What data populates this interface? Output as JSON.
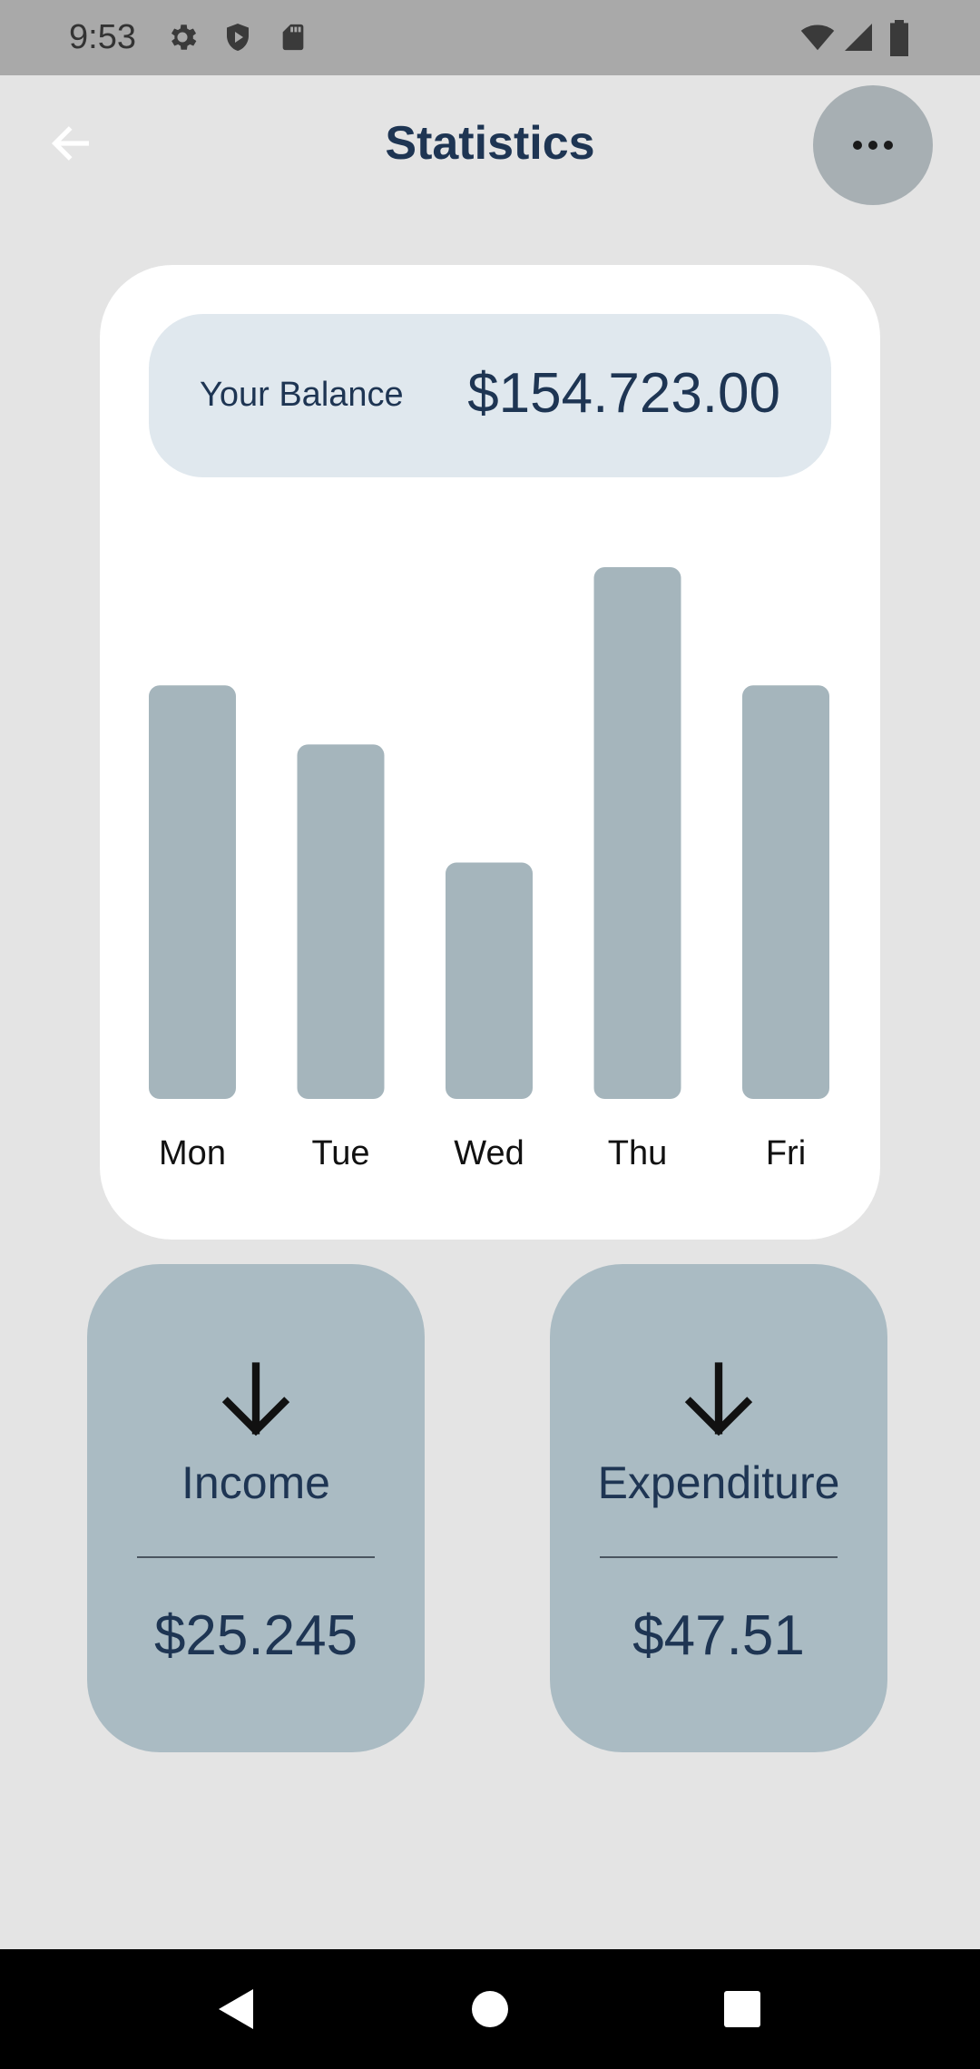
{
  "status_bar": {
    "time": "9:53",
    "left_icons": [
      "gear-icon",
      "shield-icon",
      "sd-card-icon"
    ],
    "right_icons": [
      "wifi-icon",
      "signal-icon",
      "battery-icon"
    ]
  },
  "header": {
    "title": "Statistics",
    "back_icon": "arrow-left-icon",
    "more_icon": "more-horizontal-icon"
  },
  "balance": {
    "label": "Your Balance",
    "value": "$154.723.00"
  },
  "chart_data": {
    "type": "bar",
    "categories": [
      "Mon",
      "Tue",
      "Wed",
      "Thu",
      "Fri"
    ],
    "values": [
      7,
      6,
      4,
      9,
      7
    ],
    "ylim": [
      0,
      9
    ],
    "grid": false,
    "bar_color": "#a5b5bc"
  },
  "income": {
    "title": "Income",
    "value": "$25.245",
    "icon": "arrow-down-icon"
  },
  "expenditure": {
    "title": "Expenditure",
    "value": "$47.51",
    "icon": "arrow-down-icon"
  },
  "nav_bar": {
    "icons": [
      "nav-back-icon",
      "nav-home-icon",
      "nav-recents-icon"
    ]
  },
  "colors": {
    "background": "#e4e4e4",
    "card": "#ffffff",
    "balance_box": "#e0e8ee",
    "summary_card": "#aabbc3",
    "text": "#1e3553"
  }
}
